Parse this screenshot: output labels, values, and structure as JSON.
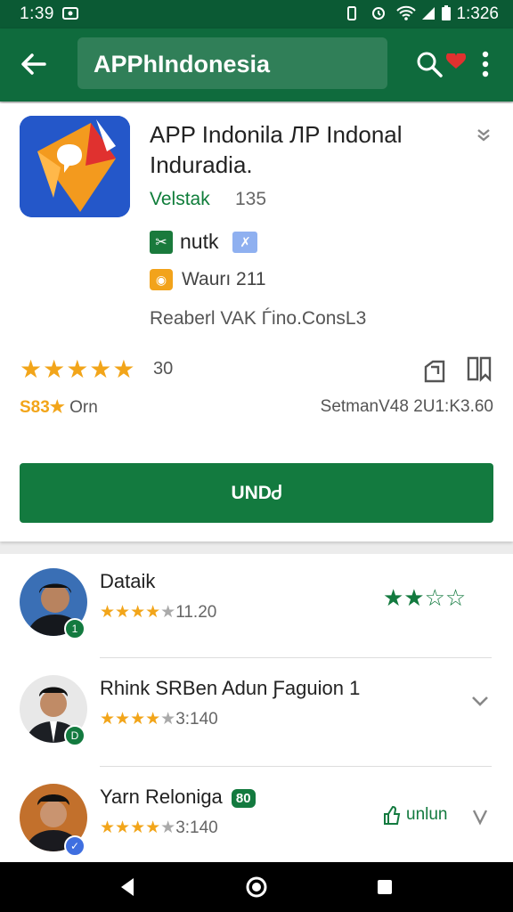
{
  "status_bar": {
    "time": "1:39",
    "clock": "1:326"
  },
  "toolbar": {
    "search_query": "APPhIndonesia"
  },
  "app": {
    "title": "APP Indonila ЛP Indonal Induradia.",
    "developer": "Velstak",
    "developer_count": "135",
    "badge_label": "nutk",
    "warning": "Waurı 211",
    "meta_line": "Reaberl VAK Ѓino.ConsL3",
    "rating_count": "30",
    "small_stat_prefix": "S83★",
    "small_stat_suffix": "Orn",
    "right_stat": "SetmanV48 2U1:K3.60",
    "install_label": "UNDᏧ"
  },
  "reviews": [
    {
      "name": "Dataik",
      "rating_text": "11.20",
      "badge": "1",
      "badge_color": "#137a3f"
    },
    {
      "name": "Rhink SRBen Adun Ƒaguion 1",
      "rating_text": "3:140",
      "badge": "D",
      "badge_color": "#137a3f"
    },
    {
      "name": "Yarn Reloniga",
      "rating_text": "3:140",
      "badge": "",
      "badge_color": "#3f6fe0",
      "tag": "80",
      "action_label": "unlun"
    }
  ],
  "colors": {
    "primary": "#0f6b3d",
    "status": "#0b5a34",
    "install": "#137a3f",
    "star": "#f2a51a"
  }
}
